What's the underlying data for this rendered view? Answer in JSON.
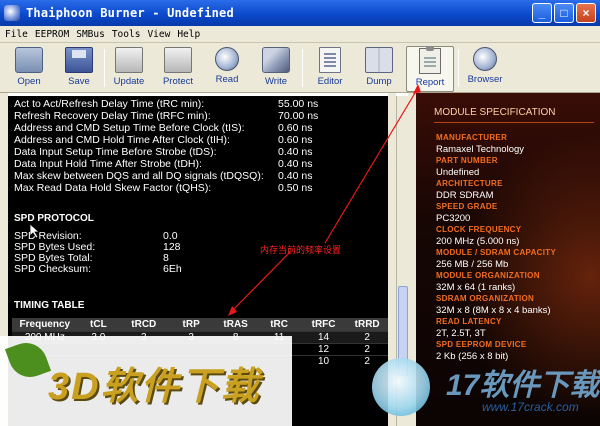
{
  "window": {
    "title": "Thaiphoon Burner - Undefined"
  },
  "menu": [
    "File",
    "EEPROM",
    "SMBus",
    "Tools",
    "View",
    "Help"
  ],
  "toolbar": [
    {
      "label": "Open",
      "icon": "open-folder-icon"
    },
    {
      "label": "Save",
      "icon": "save-disk-icon"
    },
    {
      "label": "Update",
      "icon": "update-icon"
    },
    {
      "label": "Protect",
      "icon": "protect-icon"
    },
    {
      "label": "Read",
      "icon": "read-magnifier-icon"
    },
    {
      "label": "Write",
      "icon": "write-pen-icon"
    },
    {
      "label": "Editor",
      "icon": "editor-document-icon"
    },
    {
      "label": "Dump",
      "icon": "dump-book-icon"
    },
    {
      "label": "Report",
      "icon": "report-clipboard-icon"
    },
    {
      "label": "Browser",
      "icon": "browser-magnifier-icon"
    }
  ],
  "timings_list": [
    {
      "label": "Act to Act/Refresh Delay Time (tRC min):",
      "value": "55.00 ns"
    },
    {
      "label": "Refresh Recovery Delay Time (tRFC min):",
      "value": "70.00 ns"
    },
    {
      "label": "Address and CMD Setup Time Before Clock (tIS):",
      "value": "0.60 ns"
    },
    {
      "label": "Address and CMD Hold Time After Clock (tIH):",
      "value": "0.60 ns"
    },
    {
      "label": "Data Input Setup Time Before Strobe (tDS):",
      "value": "0.40 ns"
    },
    {
      "label": "Data Input Hold Time After Strobe (tDH):",
      "value": "0.40 ns"
    },
    {
      "label": "Max skew between DQS and all DQ signals (tDQSQ):",
      "value": "0.40 ns"
    },
    {
      "label": "Max Read Data Hold Skew Factor (tQHS):",
      "value": "0.50 ns"
    }
  ],
  "spd_protocol": {
    "title": "SPD PROTOCOL",
    "rows": [
      {
        "label": "SPD Revision:",
        "value": "0.0"
      },
      {
        "label": "SPD Bytes Used:",
        "value": "128"
      },
      {
        "label": "SPD Bytes Total:",
        "value": "8"
      },
      {
        "label": "SPD Checksum:",
        "value": "6Eh"
      }
    ]
  },
  "timing_table": {
    "title": "TIMING TABLE",
    "headers": [
      "Frequency",
      "tCL",
      "tRCD",
      "tRP",
      "tRAS",
      "tRC",
      "tRFC",
      "tRRD"
    ],
    "rows": [
      [
        "200 MHz",
        "3.0",
        "3",
        "3",
        "8",
        "11",
        "14",
        "2"
      ],
      [
        "",
        "",
        "",
        "",
        "",
        "",
        "12",
        "2"
      ],
      [
        "",
        "",
        "",
        "",
        "",
        "",
        "10",
        "2"
      ]
    ]
  },
  "module_spec": {
    "title": "MODULE SPECIFICATION",
    "items": [
      {
        "key": "MANUFACTURER",
        "value": "Ramaxel Technology"
      },
      {
        "key": "PART NUMBER",
        "value": "Undefined"
      },
      {
        "key": "ARCHITECTURE",
        "value": "DDR SDRAM"
      },
      {
        "key": "SPEED GRADE",
        "value": "PC3200"
      },
      {
        "key": "CLOCK FREQUENCY",
        "value": "200 MHz (5.000 ns)"
      },
      {
        "key": "MODULE / SDRAM CAPACITY",
        "value": "256 MB / 256 Mb"
      },
      {
        "key": "MODULE ORGANIZATION",
        "value": "32M x 64 (1 ranks)"
      },
      {
        "key": "SDRAM ORGANIZATION",
        "value": "32M x 8 (8M x 8 x 4 banks)"
      },
      {
        "key": "READ LATENCY",
        "value": "2T, 2.5T, 3T"
      },
      {
        "key": "SPD EEPROM DEVICE",
        "value": "2 Kb (256 x 8 bit)"
      }
    ]
  },
  "annotation": {
    "text": "内存当前的频率设置"
  },
  "watermarks": {
    "left_text": "3D软件下载",
    "right_text": "17软件下载",
    "right_url": "www.17crack.com"
  },
  "colors": {
    "spec_key": "#f26d1f",
    "annotation_red": "#ff2222",
    "titlebar_blue": "#0a47c9"
  }
}
